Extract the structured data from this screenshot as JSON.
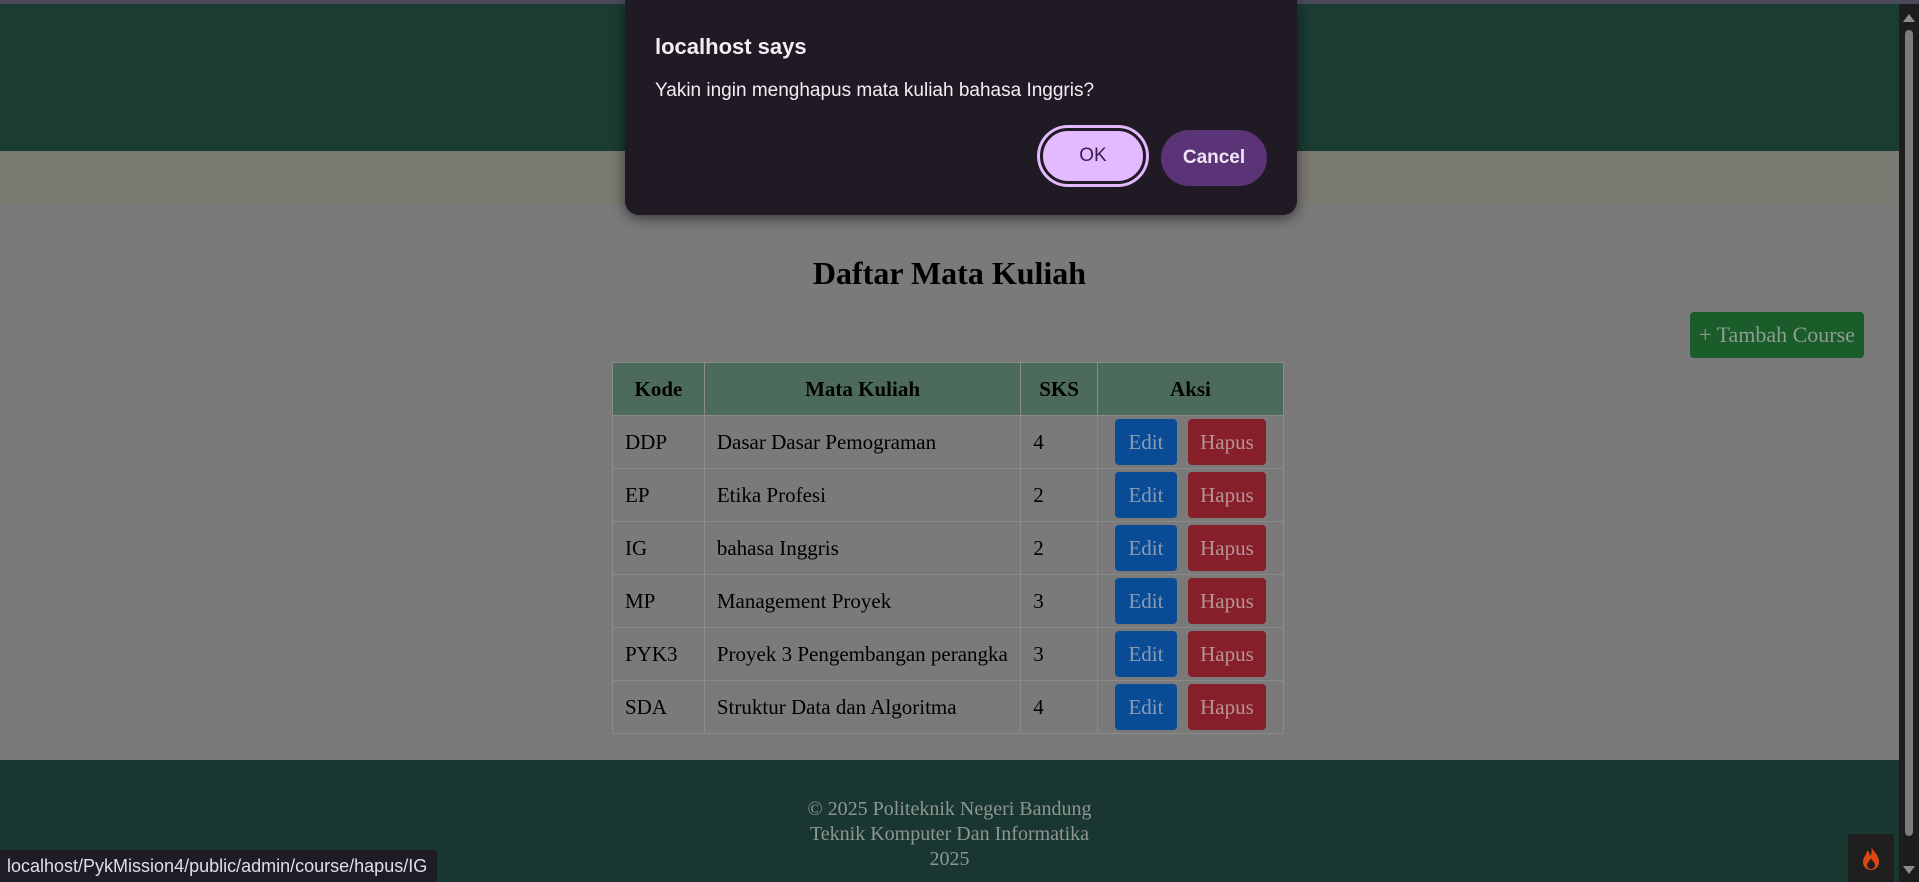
{
  "dialog": {
    "title": "localhost says",
    "message": "Yakin ingin menghapus mata kuliah bahasa Inggris?",
    "ok_label": "OK",
    "cancel_label": "Cancel"
  },
  "main": {
    "page_title": "Daftar Mata Kuliah",
    "add_button": "+ Tambah Course",
    "table": {
      "headers": [
        "Kode",
        "Mata Kuliah",
        "SKS",
        "Aksi"
      ],
      "edit_label": "Edit",
      "delete_label": "Hapus",
      "rows": [
        {
          "kode": "DDP",
          "mata_kuliah": "Dasar Dasar Pemograman",
          "sks": "4"
        },
        {
          "kode": "EP",
          "mata_kuliah": "Etika Profesi",
          "sks": "2"
        },
        {
          "kode": "IG",
          "mata_kuliah": "bahasa Inggris",
          "sks": "2"
        },
        {
          "kode": "MP",
          "mata_kuliah": "Management Proyek",
          "sks": "3"
        },
        {
          "kode": "PYK3",
          "mata_kuliah": "Proyek 3 Pengembangan perangka",
          "sks": "3"
        },
        {
          "kode": "SDA",
          "mata_kuliah": "Struktur Data dan Algoritma",
          "sks": "4"
        }
      ]
    }
  },
  "footer": {
    "line1": "© 2025 Politeknik Negeri Bandung",
    "line2": "Teknik Komputer Dan Informatika",
    "line3": "2025"
  },
  "status_bar": {
    "url": "localhost/PykMission4/public/admin/course/hapus/IG"
  },
  "colors": {
    "header_bg": "#1a3c33",
    "ok_button": "#e3b9ff",
    "cancel_button": "#5a3477",
    "edit_button": "#0a4b96",
    "delete_button": "#861f2a",
    "add_button": "#1a5c2a"
  },
  "icons": {
    "dev_toolbar": "flame-icon"
  }
}
